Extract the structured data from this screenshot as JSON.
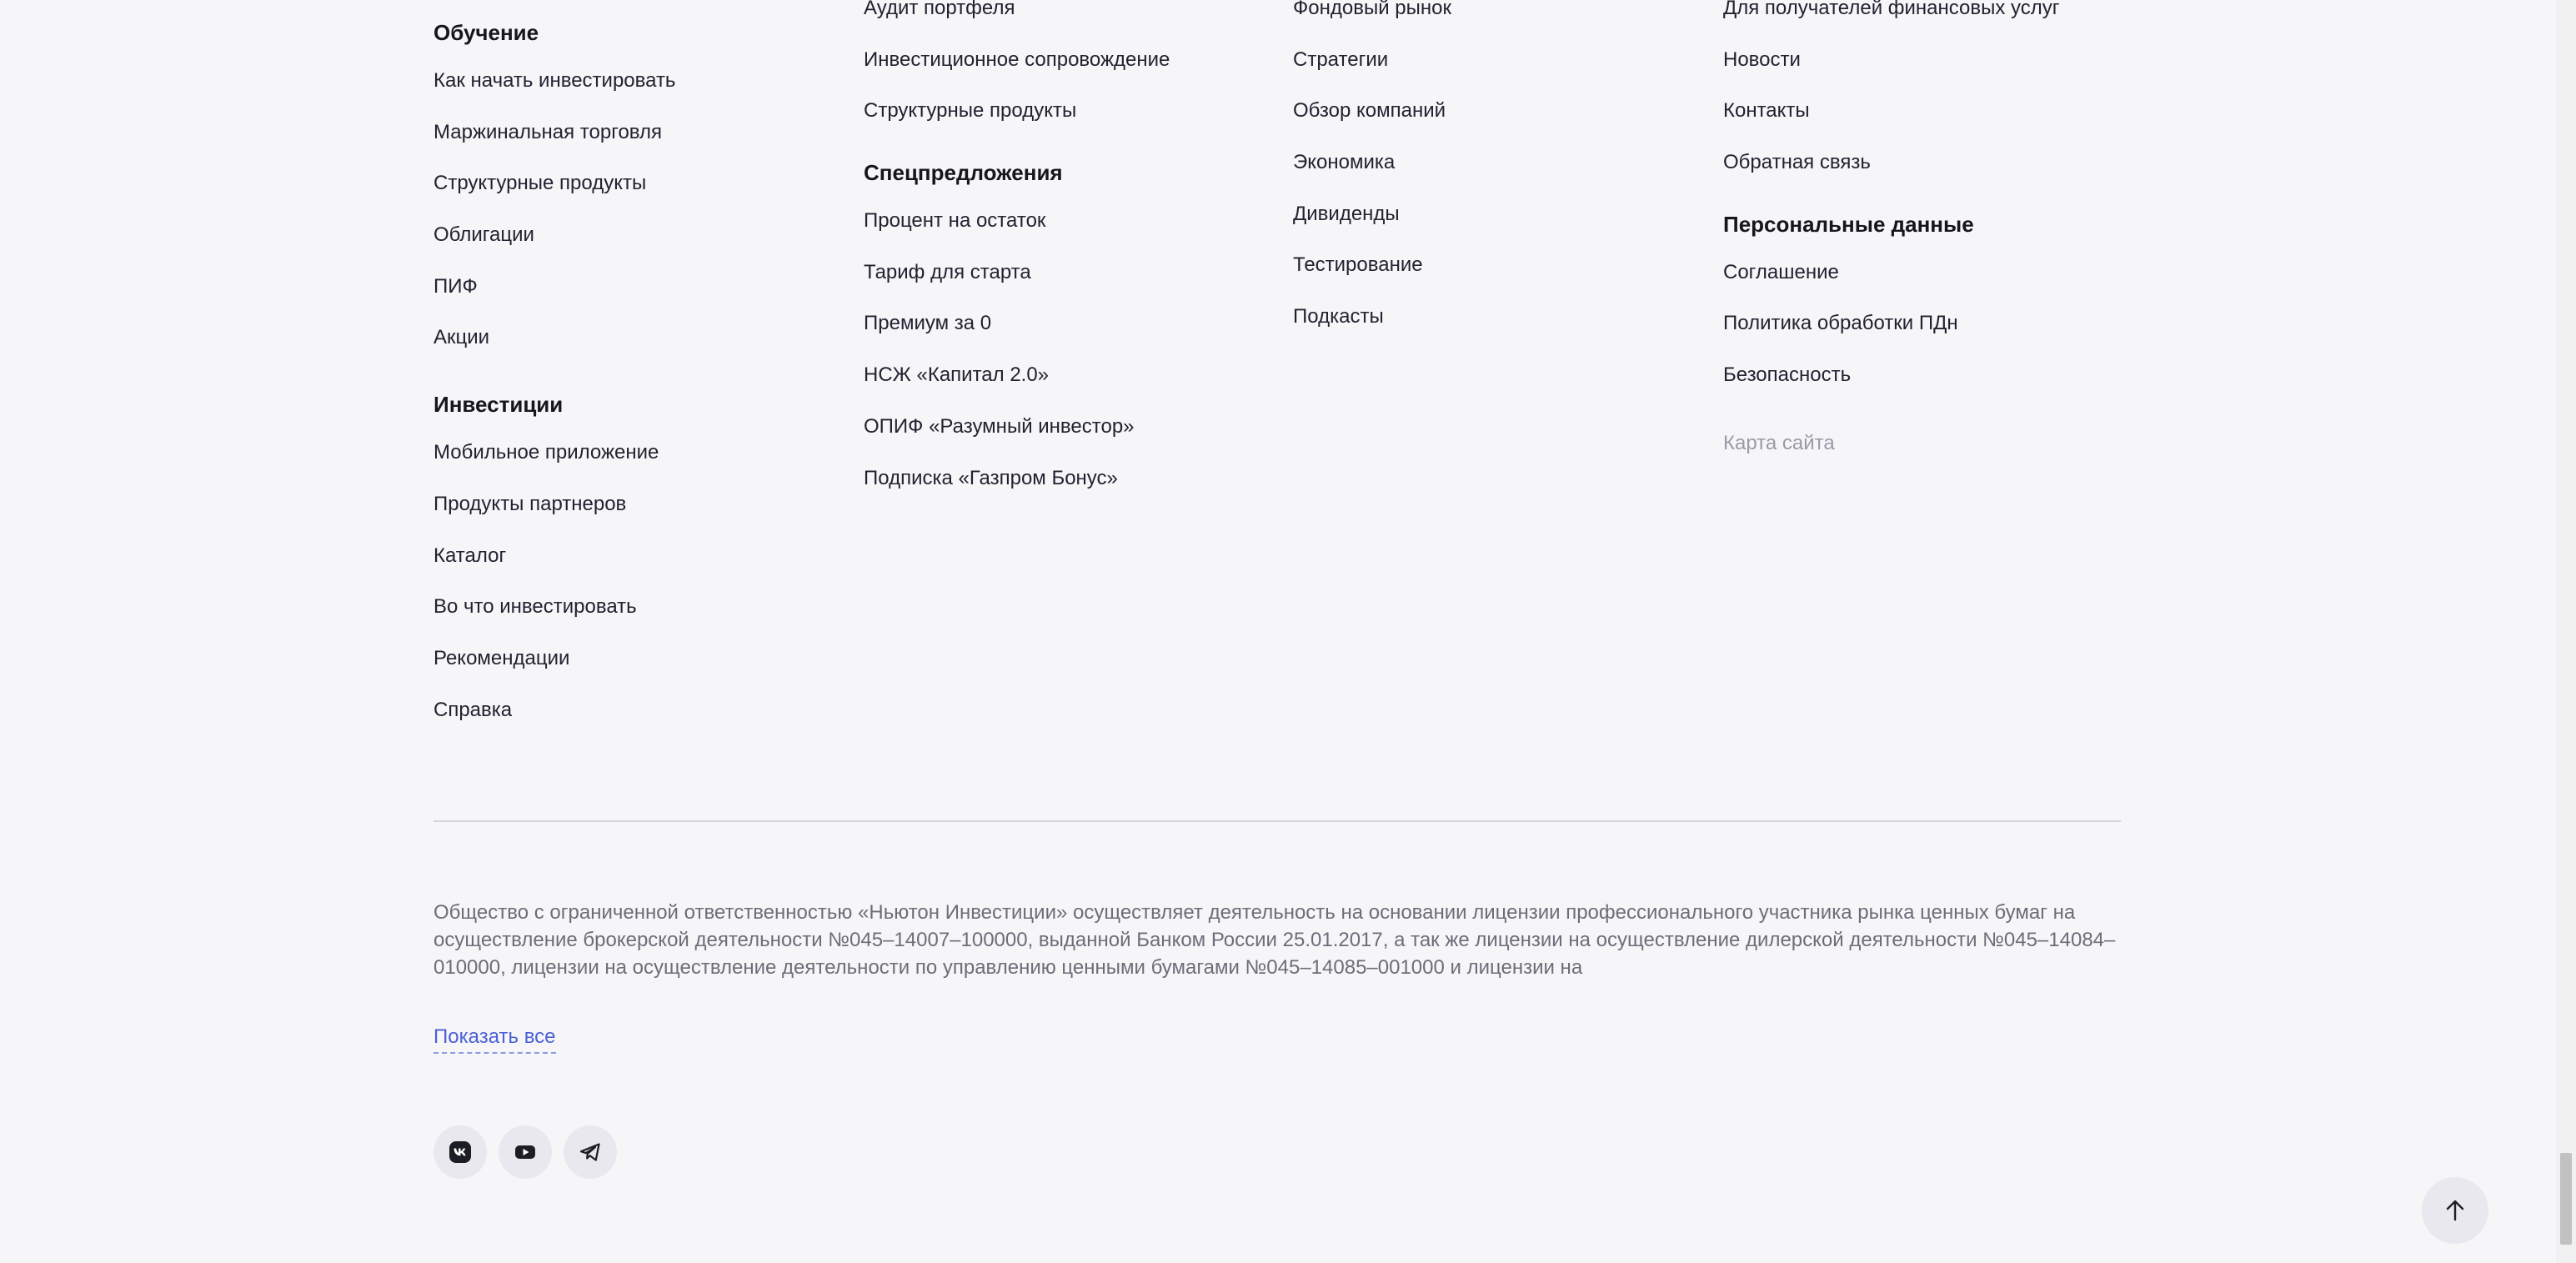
{
  "footer": {
    "col1": {
      "group1": {
        "title": "Обучение",
        "links": [
          "Как начать инвестировать",
          "Маржинальная торговля",
          "Структурные продукты",
          "Облигации",
          "ПИФ",
          "Акции"
        ]
      },
      "group2": {
        "title": "Инвестиции",
        "links": [
          "Мобильное приложение",
          "Продукты партнеров",
          "Каталог",
          "Во что инвестировать",
          "Рекомендации",
          "Справка"
        ]
      }
    },
    "col2": {
      "cont_links": [
        "Аудит портфеля",
        "Инвестиционное сопровождение",
        "Структурные продукты"
      ],
      "group": {
        "title": "Спецпредложения",
        "links": [
          "Процент на остаток",
          "Тариф для старта",
          "Премиум за 0",
          "НСЖ «Капитал 2.0»",
          "ОПИФ «Разумный инвестор»",
          "Подписка «Газпром Бонус»"
        ]
      }
    },
    "col3": {
      "cont_links": [
        "Фондовый рынок",
        "Стратегии",
        "Обзор компаний",
        "Экономика",
        "Дивиденды",
        "Тестирование",
        "Подкасты"
      ]
    },
    "col4": {
      "cont_links": [
        "Для получателей финансовых услуг",
        "Новости",
        "Контакты",
        "Обратная связь"
      ],
      "group": {
        "title": "Персональные данные",
        "links": [
          "Соглашение",
          "Политика обработки ПДн",
          "Безопасность"
        ]
      },
      "sitemap": "Карта сайта"
    },
    "legal_text": "Общество с ограниченной ответственностью «Ньютон Инвестиции» осуществляет деятельность на основании лицензии профессионального участника рынка ценных бумаг на осуществление брокерской деятельности №045–14007–100000, выданной Банком России 25.01.2017, а так же лицензии на осуществление дилерской деятельности №045–14084–010000, лицензии на осуществление деятельности по управлению ценными бумагами №045–14085–001000 и лицензии на",
    "show_all": "Показать все",
    "socials": [
      "vk-icon",
      "youtube-icon",
      "telegram-icon"
    ]
  },
  "colors": {
    "background": "#f6f6f9",
    "link_accent": "#4b60d6",
    "muted_text": "#9a9aa6"
  }
}
